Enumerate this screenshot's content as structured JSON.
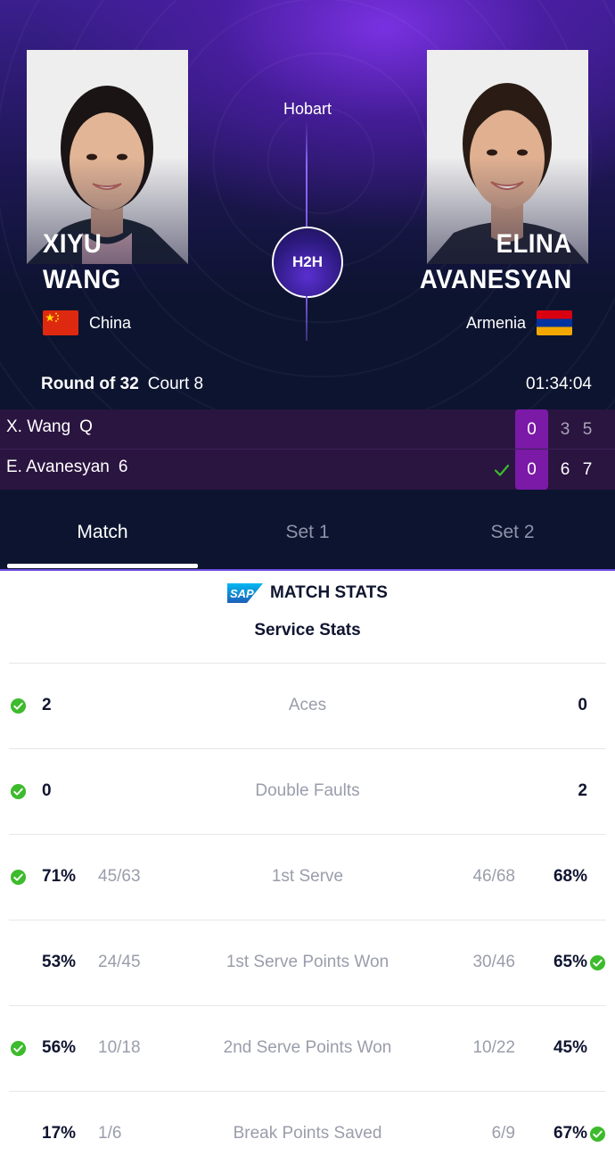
{
  "match": {
    "venue": "Hobart",
    "h2h_label": "H2H",
    "round": "Round of 32",
    "court": "Court 8",
    "duration": "01:34:04"
  },
  "players": {
    "left": {
      "first": "XIYU",
      "last": "WANG",
      "country": "China"
    },
    "right": {
      "first": "ELINA",
      "last": "AVANESYAN",
      "country": "Armenia"
    }
  },
  "scoreboard": [
    {
      "name": "X. Wang",
      "seed": "Q",
      "game": "0",
      "set1": "3",
      "set2": "5",
      "winner": false
    },
    {
      "name": "E. Avanesyan",
      "seed": "6",
      "game": "0",
      "set1": "6",
      "set2": "7",
      "winner": true
    }
  ],
  "tabs": [
    {
      "label": "Match",
      "active": true
    },
    {
      "label": "Set 1",
      "active": false
    },
    {
      "label": "Set 2",
      "active": false
    }
  ],
  "stats_header": {
    "brand": "SAP",
    "title": "MATCH STATS",
    "section": "Service Stats"
  },
  "stats": [
    {
      "label": "Aces",
      "left": "2",
      "left_frac": "",
      "right": "0",
      "right_frac": "",
      "leader": "left"
    },
    {
      "label": "Double Faults",
      "left": "0",
      "left_frac": "",
      "right": "2",
      "right_frac": "",
      "leader": "left"
    },
    {
      "label": "1st Serve",
      "left": "71%",
      "left_frac": "45/63",
      "right": "68%",
      "right_frac": "46/68",
      "leader": "left"
    },
    {
      "label": "1st Serve Points Won",
      "left": "53%",
      "left_frac": "24/45",
      "right": "65%",
      "right_frac": "30/46",
      "leader": "right"
    },
    {
      "label": "2nd Serve Points Won",
      "left": "56%",
      "left_frac": "10/18",
      "right": "45%",
      "right_frac": "10/22",
      "leader": "left"
    },
    {
      "label": "Break Points Saved",
      "left": "17%",
      "left_frac": "1/6",
      "right": "67%",
      "right_frac": "6/9",
      "leader": "right"
    }
  ],
  "colors": {
    "accent_purple": "#7a1aa6",
    "win_green": "#3dbb2c",
    "header_bg": "#0c1430"
  }
}
